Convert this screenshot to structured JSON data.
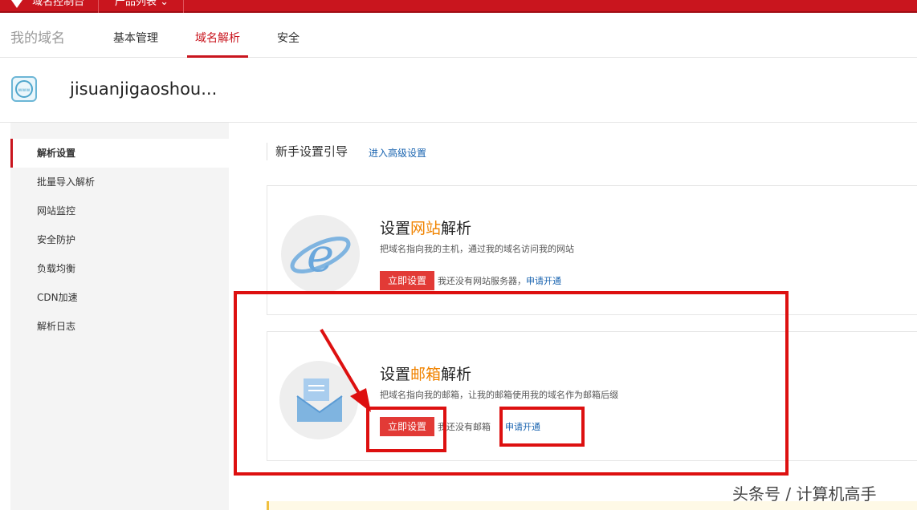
{
  "topbar": {
    "brand": "域名控制台",
    "products": "产品列表"
  },
  "nav": {
    "my_domain": "我的域名",
    "tabs": [
      {
        "label": "基本管理"
      },
      {
        "label": "域名解析"
      },
      {
        "label": "安全"
      }
    ],
    "active_tab": "域名解析"
  },
  "domain": {
    "name": "jisuanjigaoshou..."
  },
  "sidebar": {
    "items": [
      {
        "label": "解析设置"
      },
      {
        "label": "批量导入解析"
      },
      {
        "label": "网站监控"
      },
      {
        "label": "安全防护"
      },
      {
        "label": "负载均衡"
      },
      {
        "label": "CDN加速"
      },
      {
        "label": "解析日志"
      }
    ]
  },
  "main": {
    "title": "新手设置引导",
    "advanced_link": "进入高级设置",
    "cards": [
      {
        "title_pre": "设置",
        "title_hl": "网站",
        "title_post": "解析",
        "desc": "把域名指向我的主机，通过我的域名访问我的网站",
        "button": "立即设置",
        "note": "我还没有网站服务器，",
        "link": "申请开通"
      },
      {
        "title_pre": "设置",
        "title_hl": "邮箱",
        "title_post": "解析",
        "desc": "把域名指向我的邮箱，让我的邮箱使用我的域名作为邮箱后缀",
        "button": "立即设置",
        "note": "我还没有邮箱",
        "link": "申请开通"
      }
    ]
  },
  "colors": {
    "brand_red": "#c9151e",
    "button_red": "#e23a36",
    "highlight_orange": "#f08300",
    "link_blue": "#1a64b0"
  },
  "watermark": "头条号 / 计算机高手"
}
